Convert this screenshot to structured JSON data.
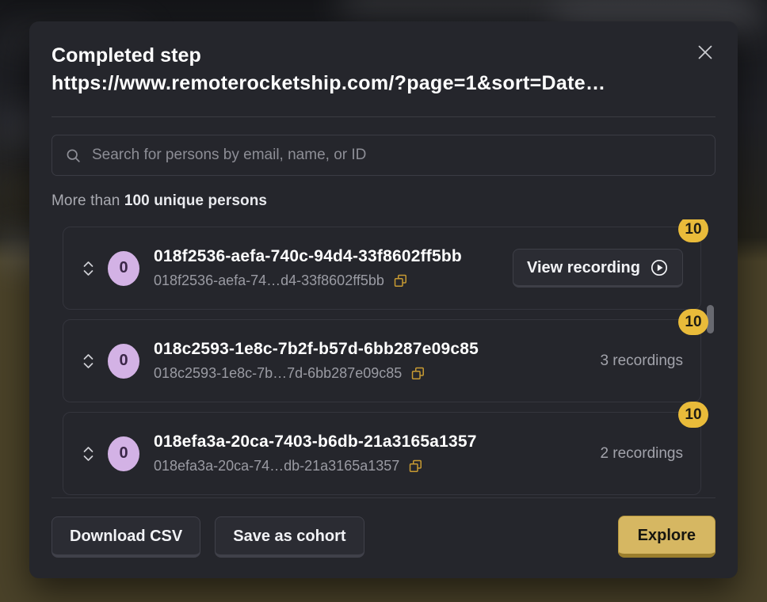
{
  "modal": {
    "title": "Completed step",
    "subtitle": "https://www.remoterocketship.com/?page=1&sort=Date…",
    "close_label": "Close",
    "close_icon": "close-icon"
  },
  "search": {
    "placeholder": "Search for persons by email, name, or ID",
    "value": "",
    "icon": "search-icon"
  },
  "summary": {
    "prefix": "More than",
    "count_text": "100 unique persons"
  },
  "list": {
    "copy_icon": "copy-icon",
    "expand_icon": "chevron-up-down-icon",
    "play_icon": "play-circle-icon",
    "rows": [
      {
        "avatar_initial": "0",
        "person_id": "018f2536-aefa-740c-94d4-33f8602ff5bb",
        "person_id_short": "018f2536-aefa-74…d4-33f8602ff5bb",
        "badge": "10",
        "action_label": "View recording",
        "action_type": "button"
      },
      {
        "avatar_initial": "0",
        "person_id": "018c2593-1e8c-7b2f-b57d-6bb287e09c85",
        "person_id_short": "018c2593-1e8c-7b…7d-6bb287e09c85",
        "badge": "10",
        "action_label": "3 recordings",
        "action_type": "text"
      },
      {
        "avatar_initial": "0",
        "person_id": "018efa3a-20ca-7403-b6db-21a3165a1357",
        "person_id_short": "018efa3a-20ca-74…db-21a3165a1357",
        "badge": "10",
        "action_label": "2 recordings",
        "action_type": "text"
      }
    ]
  },
  "footer": {
    "download_csv_label": "Download CSV",
    "save_cohort_label": "Save as cohort",
    "explore_label": "Explore"
  },
  "colors": {
    "modal_bg": "#25262c",
    "badge_gold": "#e9bb3a",
    "avatar_purple": "#d3b2e5",
    "copy_gold": "#c79a32",
    "explore_gold": "#d6b762"
  }
}
